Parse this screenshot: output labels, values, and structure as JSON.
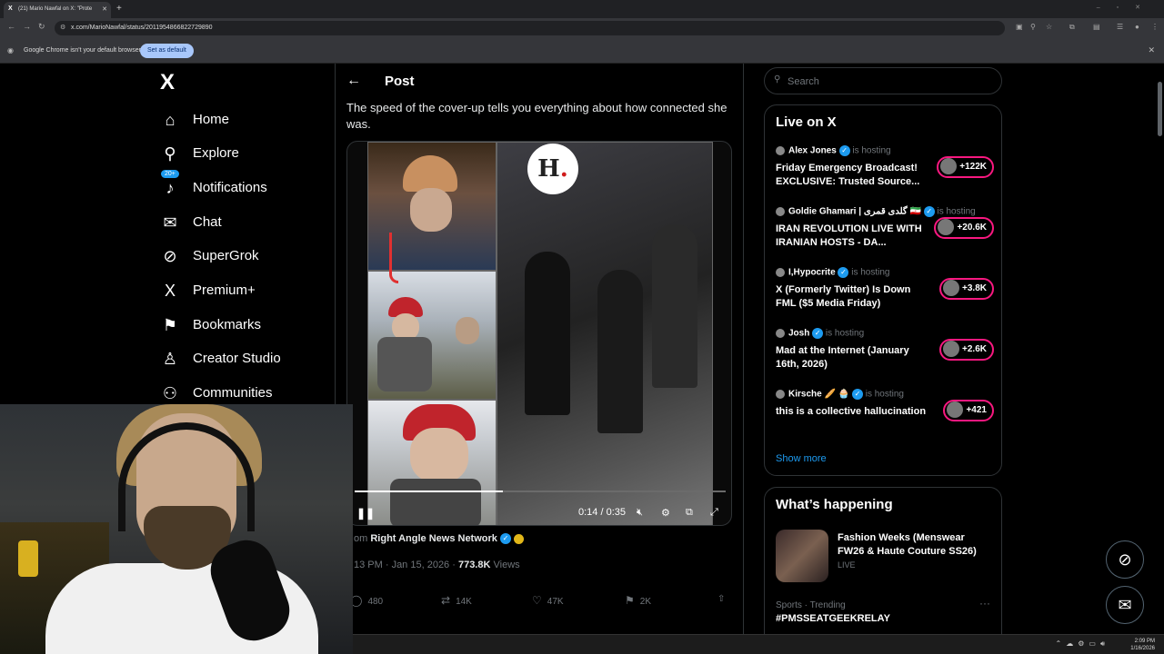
{
  "browser": {
    "tab_title": "(21) Mario Nawfal on X: \"Prote",
    "url": "x.com/MarioNawfal/status/2011954866822729890",
    "infobar_message": "Google Chrome isn't your default browser",
    "infobar_button": "Set as default"
  },
  "nav": {
    "logo": "X",
    "notifications_badge": "20+",
    "items": [
      {
        "label": "Home",
        "icon": "home-icon"
      },
      {
        "label": "Explore",
        "icon": "search-icon"
      },
      {
        "label": "Notifications",
        "icon": "bell-icon"
      },
      {
        "label": "Chat",
        "icon": "mail-icon"
      },
      {
        "label": "SuperGrok",
        "icon": "grok-icon"
      },
      {
        "label": "Premium+",
        "icon": "x-icon"
      },
      {
        "label": "Bookmarks",
        "icon": "bookmark-icon"
      },
      {
        "label": "Creator Studio",
        "icon": "creator-icon"
      },
      {
        "label": "Communities",
        "icon": "communities-icon"
      }
    ]
  },
  "post": {
    "header": "Post",
    "text": "The speed of the cover-up tells you everything about how connected she was.",
    "media_badge": "H",
    "video_time": "0:14 / 0:35",
    "video_progress": 0.4,
    "from_prefix": "om",
    "from_source": "Right Angle News Network",
    "meta_time": "13 PM · Jan 15, 2026 · ",
    "views_count": "773.8K",
    "views_label": " Views",
    "replies": "480",
    "reposts": "14K",
    "likes": "47K",
    "bookmarks": "2K"
  },
  "right": {
    "search_placeholder": "Search",
    "live_title": "Live on X",
    "live": [
      {
        "host": "Alex Jones",
        "status": "is hosting",
        "title": "Friday Emergency Broadcast! EXCLUSIVE: Trusted Source...",
        "count": "+122K"
      },
      {
        "host": "Goldie Ghamari | گلدی قمری 🇮🇷",
        "status": "is hosting",
        "title": "IRAN REVOLUTION LIVE WITH IRANIAN HOSTS - DA...",
        "count": "+20.6K"
      },
      {
        "host": "I,Hypocrite",
        "status": "is hosting",
        "title": "X (Formerly Twitter) Is Down FML ($5 Media Friday)",
        "count": "+3.8K"
      },
      {
        "host": "Josh",
        "status": "is hosting",
        "title": "Mad at the Internet (January 16th, 2026)",
        "count": "+2.6K"
      },
      {
        "host": "Kirsche 🥖 🧁",
        "status": "is hosting",
        "title": "this is a collective hallucination",
        "count": "+421"
      }
    ],
    "show_more": "Show more",
    "happening_title": "What’s happening",
    "trend_title": "Fashion Weeks (Menswear FW26 & Haute Couture SS26)",
    "trend_live": "LIVE",
    "trend_category": "Sports · Trending",
    "trend_tag": "#PMSSEATGEEKRELAY"
  },
  "taskbar": {
    "time": "2:09 PM",
    "date": "1/16/2026"
  }
}
